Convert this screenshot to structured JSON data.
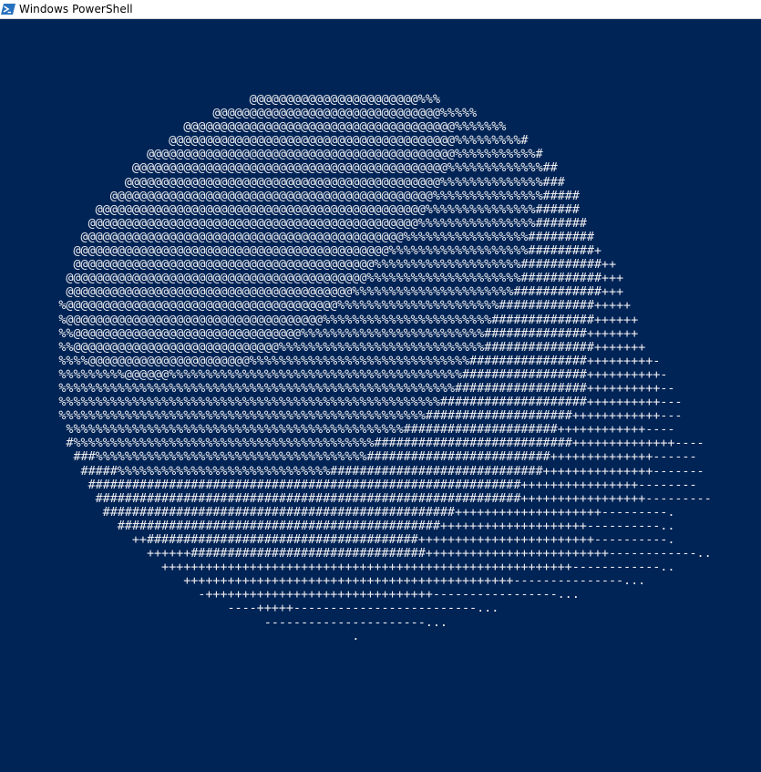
{
  "window": {
    "title": "Windows PowerShell",
    "icon": "powershell-icon",
    "background_color": "#012456",
    "text_color": "#eeedf0"
  },
  "console": {
    "lines": [
      "                                  @@@@@@@@@@@@@@@@@@@@@@@%%%",
      "                             @@@@@@@@@@@@@@@@@@@@@@@@@@@@@@@%%%%%",
      "                         @@@@@@@@@@@@@@@@@@@@@@@@@@@@@@@@@@@@@%%%%%%%",
      "                       @@@@@@@@@@@@@@@@@@@@@@@@@@@@@@@@@@@@@@@%%%%%%%%%#",
      "                    @@@@@@@@@@@@@@@@@@@@@@@@@@@@@@@@@@@@@@@@@@%%%%%%%%%%%#",
      "                  @@@@@@@@@@@@@@@@@@@@@@@@@@@@@@@@@@@@@@@@@@@%%%%%%%%%%%%%##",
      "                 @@@@@@@@@@@@@@@@@@@@@@@@@@@@@@@@@@@@@@@@@@@%%%%%%%%%%%%%%###",
      "               @@@@@@@@@@@@@@@@@@@@@@@@@@@@@@@@@@@@@@@@@@@@%%%%%%%%%%%%%%%#####",
      "             @@@@@@@@@@@@@@@@@@@@@@@@@@@@@@@@@@@@@@@@@@@@@%%%%%%%%%%%%%%%######",
      "            @@@@@@@@@@@@@@@@@@@@@@@@@@@@@@@@@@@@@@@@@@@@@%%%%%%%%%%%%%%%%#######",
      "           @@@@@@@@@@@@@@@@@@@@@@@@@@@@@@@@@@@@@@@@@@@@%%%%%%%%%%%%%%%%%#########",
      "          @@@@@@@@@@@@@@@@@@@@@@@@@@@@@@@@@@@@@@@@@@@%%%%%%%%%%%%%%%%%%%#########+",
      "          @@@@@@@@@@@@@@@@@@@@@@@@@@@@@@@@@@@@@@@@@%%%%%%%%%%%%%%%%%%%%###########++",
      "         @@@@@@@@@@@@@@@@@@@@@@@@@@@@@@@@@@@@@@@@@%%%%%%%%%%%%%%%%%%%%%###########+++",
      "         @@@@@@@@@@@@@@@@@@@@@@@@@@@@@@@@@@@@@@@%%%%%%%%%%%%%%%%%%%%%%############+++",
      "        %@@@@@@@@@@@@@@@@@@@@@@@@@@@@@@@@@@@@@%%%%%%%%%%%%%%%%%%%%%%#############+++++",
      "        %@@@@@@@@@@@@@@@@@@@@@@@@@@@@@@@@@@@%%%%%%%%%%%%%%%%%%%%%%%##############++++++",
      "        %%@@@@@@@@@@@@@@@@@@@@@@@@@@@@@@@%%%%%%%%%%%%%%%%%%%%%%%%%##############+++++++",
      "        %%@@@@@@@@@@@@@@@@@@@@@@@@@@@@%%%%%%%%%%%%%%%%%%%%%%%%%%%%###############+++++++",
      "        %%%%@@@@@@@@@@@@@@@@@@@@@@%%%%%%%%%%%%%%%%%%%%%%%%%%%%%%################+++++++++-",
      "        %%%%%%%%%@@@@@@%%%%%%%%%%%%%%%%%%%%%%%%%%%%%%%%%%%%%%%%#################++++++++++-",
      "        %%%%%%%%%%%%%%%%%%%%%%%%%%%%%%%%%%%%%%%%%%%%%%%%%%%%%%##################++++++++++--",
      "        %%%%%%%%%%%%%%%%%%%%%%%%%%%%%%%%%%%%%%%%%%%%%%%%%%%%####################++++++++++---",
      "        %%%%%%%%%%%%%%%%%%%%%%%%%%%%%%%%%%%%%%%%%%%%%%%%%%####################++++++++++++---",
      "         %%%%%%%%%%%%%%%%%%%%%%%%%%%%%%%%%%%%%%%%%%%%%%#####################++++++++++++----",
      "         #%%%%%%%%%%%%%%%%%%%%%%%%%%%%%%%%%%%%%%%%%###########################++++++++++++++----",
      "          ###%%%%%%%%%%%%%%%%%%%%%%%%%%%%%%%%%%%%%#########################++++++++++++++------",
      "           #####%%%%%%%%%%%%%%%%%%%%%%%%%%%%%#############################+++++++++++++++-------",
      "            ###########################################################++++++++++++++++--------",
      "             ##########################################################+++++++++++++++++---------",
      "              ################################################++++++++++++++++++++---------.",
      "                ############################################++++++++++++++++++++----------..",
      "                  ++#####################################++++++++++++++++++++++++----------.",
      "                    ++++++################################+++++++++++++++++++++++++------------..",
      "                      ++++++++++++++++++++++++++++++++++++++++++++++++++++++++------------..",
      "                         +++++++++++++++++++++++++++++++++++++++++++++---------------...",
      "                           -+++++++++++++++++++++++++++++++-----------------...",
      "                               ----+++++-------------------------...",
      "                                    ----------------------...",
      "                                                .",
      ""
    ]
  }
}
